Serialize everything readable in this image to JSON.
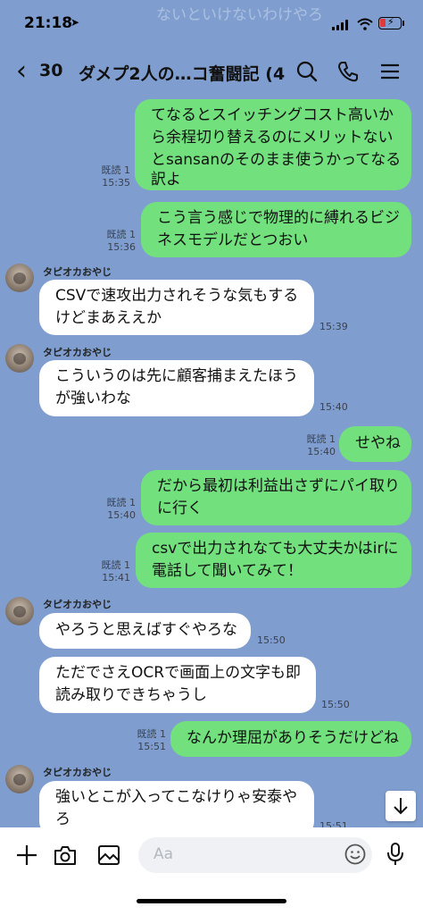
{
  "status": {
    "time": "21:18",
    "background_notice": "ないといけないわけやろ"
  },
  "header": {
    "back_count": "30",
    "title": "ダメプ2人の…コ奮闘記 (4)"
  },
  "messages": [
    {
      "side": "mine",
      "lines": [
        "てなるとスイッチングコスト高いか",
        "ら余程切り替えるのにメリットない",
        "とsansanのそのまま使うかってなる",
        "訳よ"
      ],
      "read": "既読 1",
      "time": "15:35"
    },
    {
      "side": "mine",
      "lines": [
        "こう言う感じで物理的に縛れるビジ",
        "ネスモデルだとつおい"
      ],
      "read": "既読 1",
      "time": "15:36"
    },
    {
      "side": "theirs",
      "sender": "タピオカおやじ",
      "lines": [
        "CSVで速攻出力されそうな気もする",
        "けどまあええか"
      ],
      "time": "15:39"
    },
    {
      "side": "theirs",
      "sender": "タピオカおやじ",
      "lines": [
        "こういうのは先に顧客捕まえたほう",
        "が強いわな"
      ],
      "time": "15:40"
    },
    {
      "side": "mine",
      "lines": [
        "せやね"
      ],
      "read": "既読 1",
      "time": "15:40"
    },
    {
      "side": "mine",
      "lines": [
        "だから最初は利益出さずにパイ取り",
        "に行く"
      ],
      "read": "既読 1",
      "time": "15:40"
    },
    {
      "side": "mine",
      "lines": [
        "csvで出力されなても大丈夫かはirに",
        "電話して聞いてみて！"
      ],
      "read": "既読 1",
      "time": "15:41"
    },
    {
      "side": "theirs",
      "sender": "タピオカおやじ",
      "lines": [
        "やろうと思えばすぐやろな"
      ],
      "time": "15:50"
    },
    {
      "side": "theirs",
      "lines": [
        "ただでさえOCRで画面上の文字も即",
        "読み取りできちゃうし"
      ],
      "time": "15:50"
    },
    {
      "side": "mine",
      "lines": [
        "なんか理屈がありそうだけどね"
      ],
      "read": "既読 1",
      "time": "15:51"
    },
    {
      "side": "theirs",
      "sender": "タピオカおやじ",
      "lines": [
        "強いとこが入ってこなけりゃ安泰や",
        "ろ"
      ],
      "time": "15:51"
    }
  ],
  "input": {
    "placeholder": "Aa"
  },
  "colors": {
    "background": "#7f9ecf",
    "mine_bubble": "#71e07d",
    "theirs_bubble": "#ffffff"
  },
  "icons": [
    "back-icon",
    "search-icon",
    "phone-icon",
    "menu-icon",
    "arrow-down-icon",
    "plus-icon",
    "camera-icon",
    "image-icon",
    "emoji-icon",
    "microphone-icon"
  ]
}
